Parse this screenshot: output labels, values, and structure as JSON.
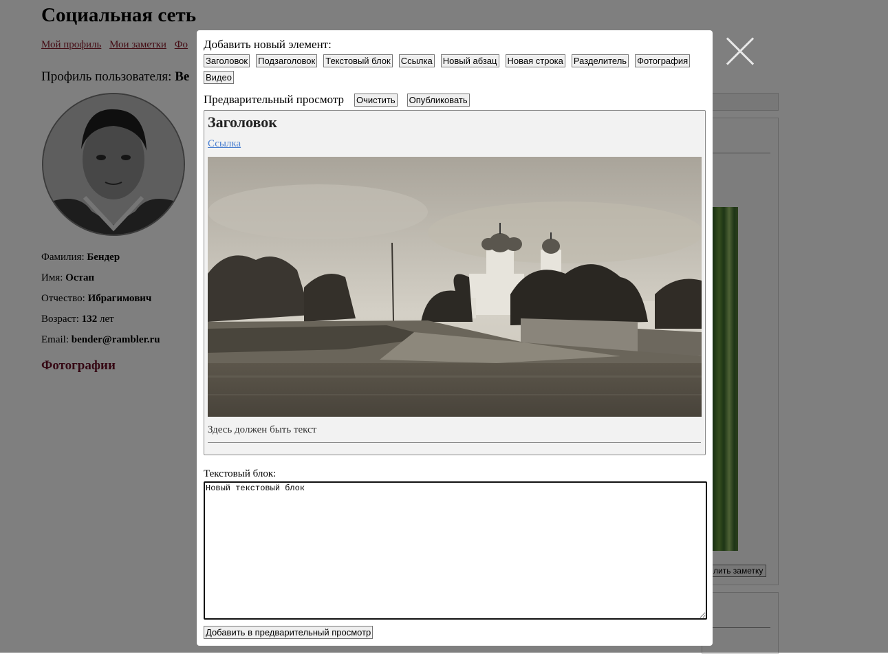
{
  "site": {
    "title": "Социальная сеть",
    "nav": [
      "Мой профиль",
      "Мои заметки",
      "Фо"
    ]
  },
  "profile": {
    "heading_prefix": "Профиль пользователя:",
    "heading_name": "Be",
    "fields": [
      {
        "label": "Фамилия:",
        "value": "Бендер"
      },
      {
        "label": "Имя:",
        "value": "Остап"
      },
      {
        "label": "Отчество:",
        "value": "Ибрагимович"
      },
      {
        "label": "Возраст:",
        "value": "132",
        "suffix": "лет"
      },
      {
        "label": "Email:",
        "value": "bender@rambler.ru"
      }
    ],
    "photos_heading": "Фотографии"
  },
  "background_right": {
    "button_fragment": "лить заметку"
  },
  "modal": {
    "add_label": "Добавить новый элемент:",
    "element_buttons": [
      "Заголовок",
      "Подзаголовок",
      "Текстовый блок",
      "Ссылка",
      "Новый абзац",
      "Новая строка",
      "Разделитель",
      "Фотография",
      "Видео"
    ],
    "preview_label": "Предварительный просмотр",
    "clear_button": "Очистить",
    "publish_button": "Опубликовать",
    "preview": {
      "title": "Заголовок",
      "link": "Ссылка",
      "text": "Здесь должен быть текст"
    },
    "textblock_label": "Текстовый блок:",
    "textblock_value": "Новый текстовый блок",
    "add_to_preview_button": "Добавить в предварительный просмотр"
  },
  "colors": {
    "nav_link": "#8b1c2c",
    "photos_heading": "#6b0f26",
    "preview_link": "#4a7fd0",
    "overlay": "rgba(0,0,0,0.5)"
  },
  "icons": {
    "close": "close-icon"
  }
}
